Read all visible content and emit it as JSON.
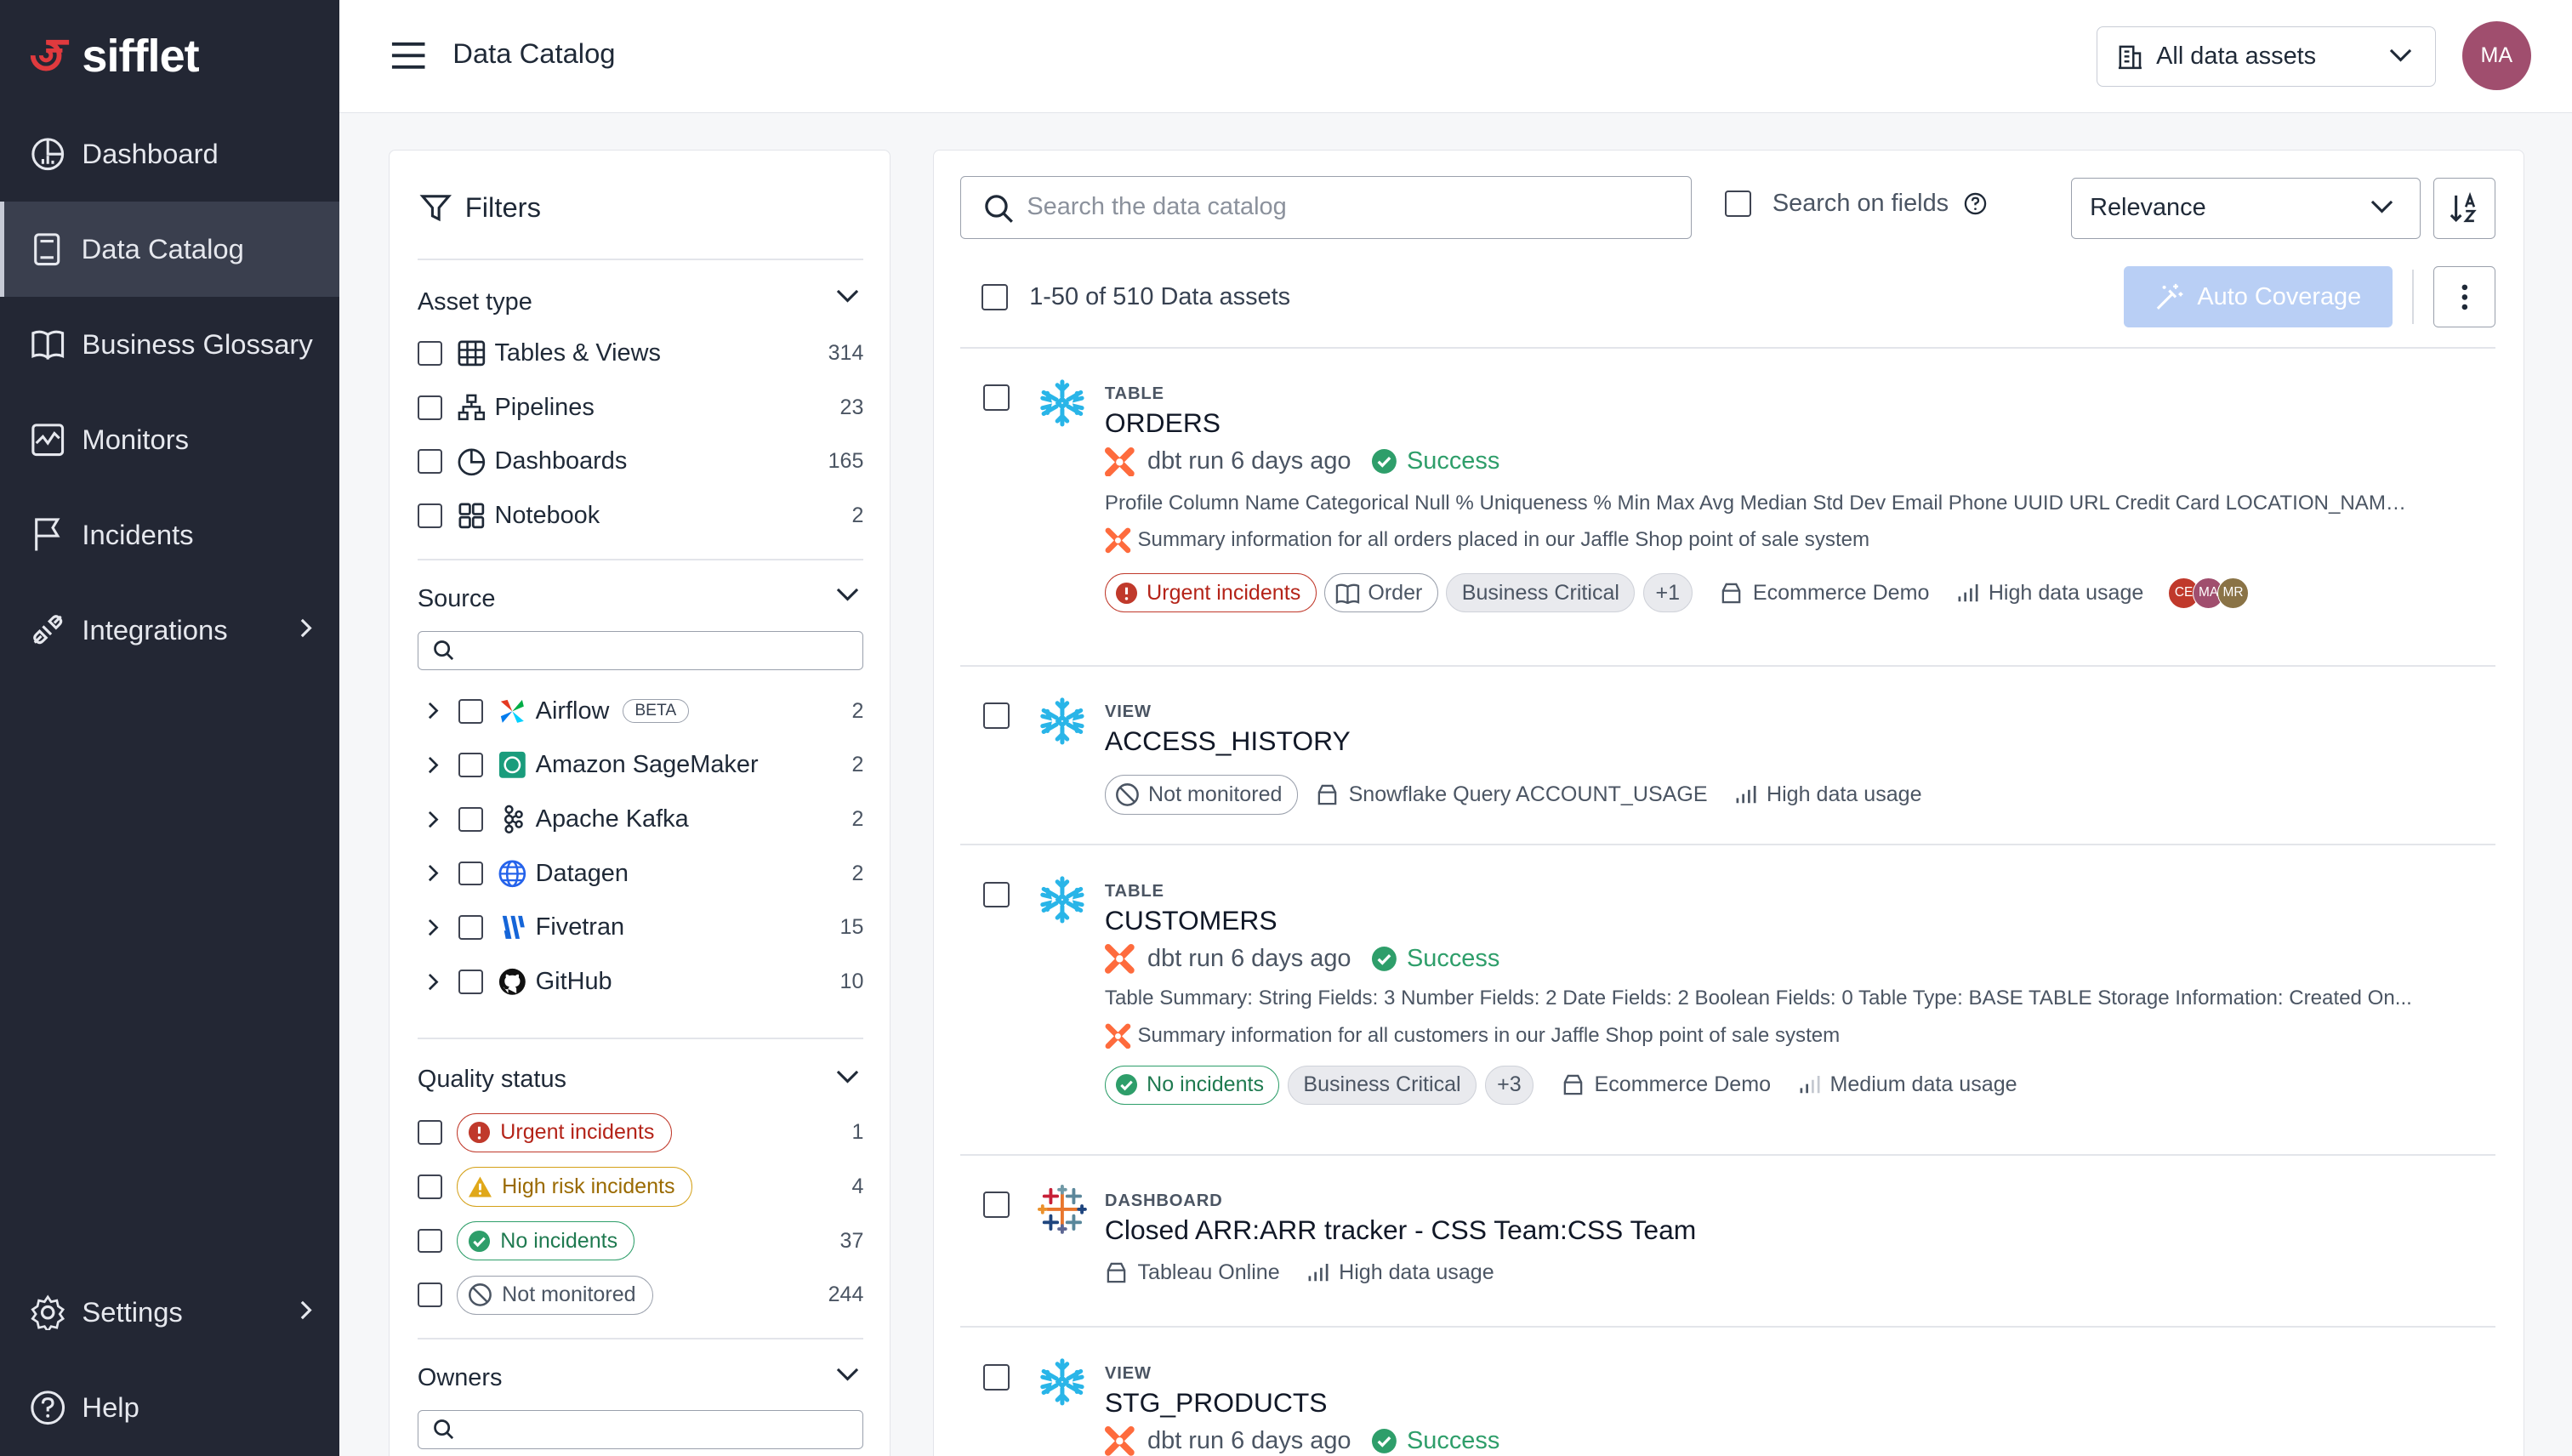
{
  "brand": {
    "name": "sifflet"
  },
  "sidebar": {
    "items": [
      {
        "label": "Dashboard",
        "icon": "dashboard-icon"
      },
      {
        "label": "Data Catalog",
        "icon": "catalog-icon",
        "active": true
      },
      {
        "label": "Business Glossary",
        "icon": "book-icon"
      },
      {
        "label": "Monitors",
        "icon": "monitor-icon"
      },
      {
        "label": "Incidents",
        "icon": "flag-icon"
      },
      {
        "label": "Integrations",
        "icon": "plug-icon"
      }
    ],
    "bottom": [
      {
        "label": "Settings",
        "icon": "gear-icon"
      },
      {
        "label": "Help",
        "icon": "help-icon"
      }
    ]
  },
  "header": {
    "title": "Data Catalog",
    "asset_select": "All data assets",
    "avatar": "MA"
  },
  "filters": {
    "title": "Filters",
    "asset_type": {
      "title": "Asset type",
      "items": [
        {
          "label": "Tables & Views",
          "count": "314"
        },
        {
          "label": "Pipelines",
          "count": "23"
        },
        {
          "label": "Dashboards",
          "count": "165"
        },
        {
          "label": "Notebook",
          "count": "2"
        }
      ]
    },
    "source": {
      "title": "Source",
      "items": [
        {
          "label": "Airflow",
          "badge": "BETA",
          "count": "2"
        },
        {
          "label": "Amazon SageMaker",
          "count": "2"
        },
        {
          "label": "Apache Kafka",
          "count": "2"
        },
        {
          "label": "Datagen",
          "count": "2"
        },
        {
          "label": "Fivetran",
          "count": "15"
        },
        {
          "label": "GitHub",
          "count": "10"
        }
      ]
    },
    "quality": {
      "title": "Quality status",
      "items": [
        {
          "label": "Urgent incidents",
          "count": "1"
        },
        {
          "label": "High risk incidents",
          "count": "4"
        },
        {
          "label": "No incidents",
          "count": "37"
        },
        {
          "label": "Not monitored",
          "count": "244"
        }
      ]
    },
    "owners": {
      "title": "Owners"
    }
  },
  "results": {
    "search_placeholder": "Search the data catalog",
    "search_on_fields": "Search on fields",
    "sort": "Relevance",
    "count_label": "1-50 of 510 Data assets",
    "auto_coverage": "Auto Coverage",
    "items": [
      {
        "kind": "TABLE",
        "name": "ORDERS",
        "run": "dbt run 6 days ago",
        "status": "Success",
        "desc": "Profile Column Name Categorical Null % Uniqueness % Min Max Avg Median Std Dev Email Phone UUID URL Credit Card LOCATION_NAME ...",
        "summary": "Summary information for all orders placed in our Jaffle Shop point of sale system",
        "incident": "Urgent incidents",
        "term": "Order",
        "tag": "Business Critical",
        "more": "+1",
        "domain": "Ecommerce Demo",
        "usage": "High data usage",
        "owners": [
          "CE",
          "MA",
          "MR"
        ]
      },
      {
        "kind": "VIEW",
        "name": "ACCESS_HISTORY",
        "incident": "Not monitored",
        "domain": "Snowflake Query ACCOUNT_USAGE",
        "usage": "High data usage"
      },
      {
        "kind": "TABLE",
        "name": "CUSTOMERS",
        "run": "dbt run 6 days ago",
        "status": "Success",
        "desc": "Table Summary: String Fields: 3 Number Fields: 2 Date Fields: 2 Boolean Fields: 0 Table Type: BASE TABLE Storage Information: Created On...",
        "summary": "Summary information for all customers in our Jaffle Shop point of sale system",
        "incident": "No incidents",
        "tag": "Business Critical",
        "more": "+3",
        "domain": "Ecommerce Demo",
        "usage": "Medium data usage"
      },
      {
        "kind": "DASHBOARD",
        "name": "Closed ARR:ARR tracker - CSS Team:CSS Team",
        "domain": "Tableau Online",
        "usage": "High data usage"
      },
      {
        "kind": "VIEW",
        "name": "STG_PRODUCTS",
        "run": "dbt run 6 days ago",
        "status": "Success"
      }
    ]
  },
  "colors": {
    "sidebar": "#232734",
    "accent": "#e03a3e",
    "success": "#2e9e6a",
    "urgent": "#c0392b",
    "auto_coverage": "#b9cff5",
    "snowflake": "#29b5e8"
  }
}
